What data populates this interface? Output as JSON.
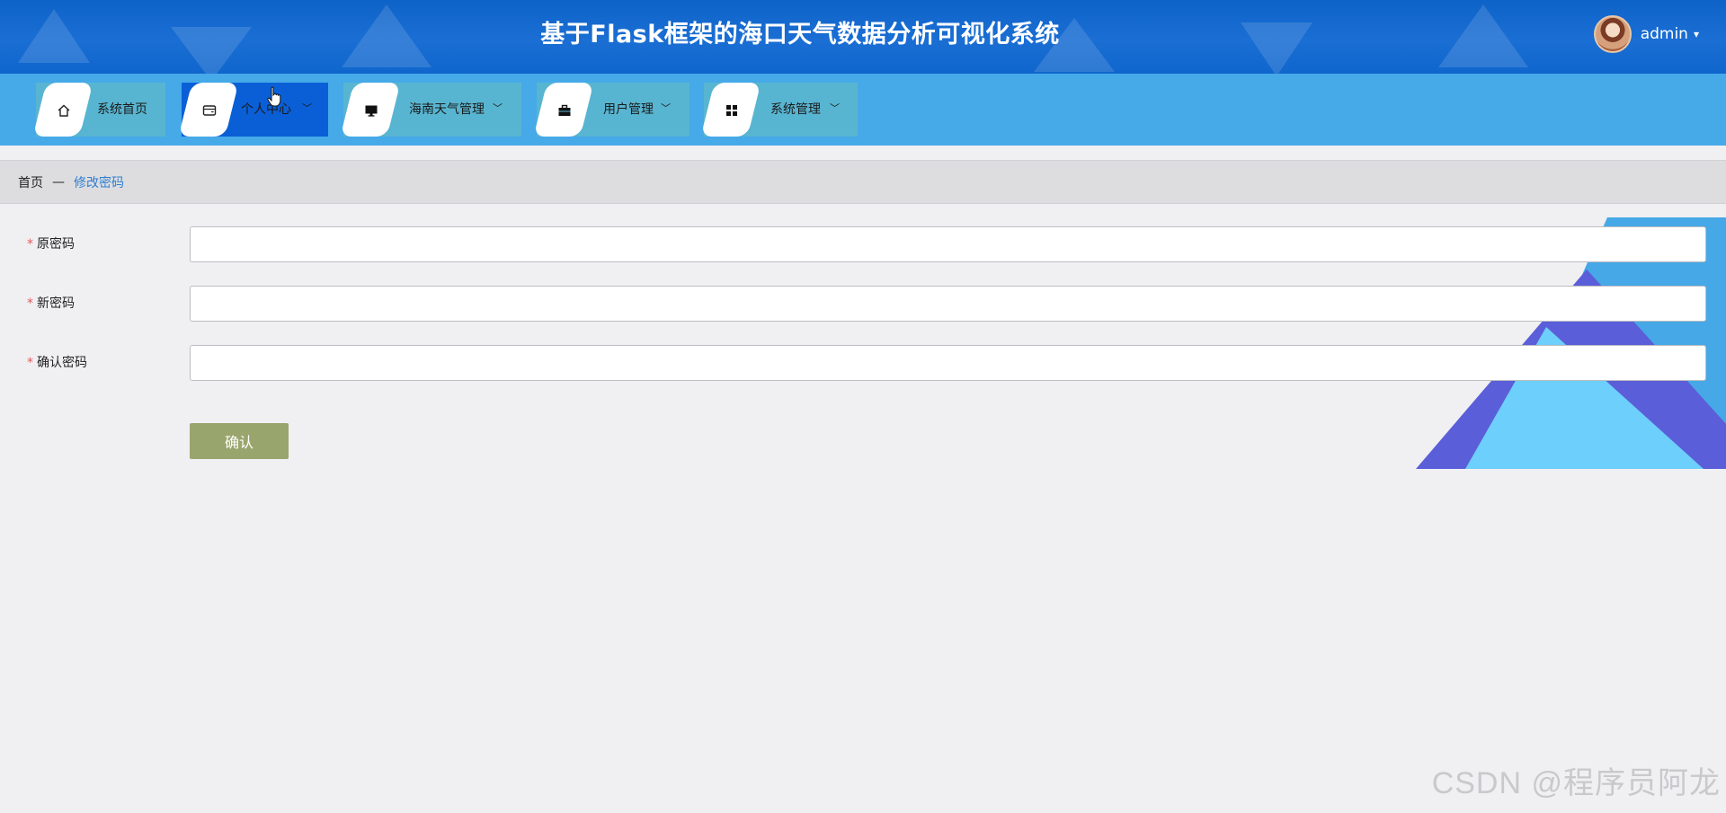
{
  "header": {
    "title": "基于Flask框架的海口天气数据分析可视化系统",
    "user": {
      "name": "admin",
      "caret": "▾"
    }
  },
  "nav": {
    "items": [
      {
        "label": "系统首页",
        "icon": "home-icon",
        "has_dropdown": false,
        "active": false
      },
      {
        "label": "个人中心",
        "icon": "wallet-icon",
        "has_dropdown": true,
        "active": true
      },
      {
        "label": "海南天气管理",
        "icon": "monitor-icon",
        "has_dropdown": true,
        "active": false
      },
      {
        "label": "用户管理",
        "icon": "briefcase-icon",
        "has_dropdown": true,
        "active": false
      },
      {
        "label": "系统管理",
        "icon": "grid-icon",
        "has_dropdown": true,
        "active": false
      }
    ],
    "chevron": "﹀"
  },
  "breadcrumb": {
    "home": "首页",
    "separator": "—",
    "current": "修改密码"
  },
  "form": {
    "required_mark": "*",
    "fields": [
      {
        "label": "原密码",
        "value": "",
        "placeholder": ""
      },
      {
        "label": "新密码",
        "value": "",
        "placeholder": ""
      },
      {
        "label": "确认密码",
        "value": "",
        "placeholder": ""
      }
    ],
    "submit_label": "确认"
  },
  "watermark": "CSDN @程序员阿龙",
  "colors": {
    "header": "#1168cf",
    "nav_bg": "#46a9e8",
    "nav_item": "#58b5d1",
    "nav_active": "#0a5fd6",
    "confirm": "#98a56d",
    "breadcrumb_link": "#2f7fd1",
    "required": "#e05b5b"
  }
}
